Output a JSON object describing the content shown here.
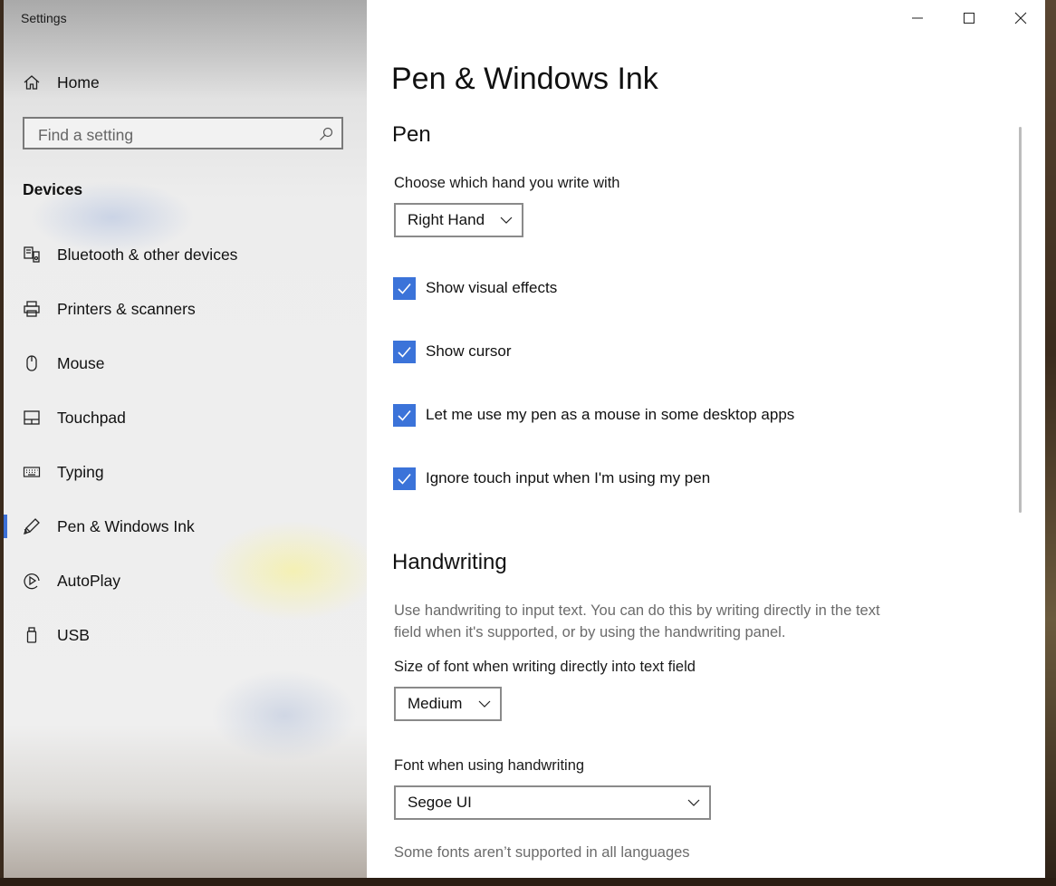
{
  "window": {
    "app_title": "Settings",
    "caption": {
      "minimize": "minimize-icon",
      "maximize": "maximize-icon",
      "close": "close-icon"
    }
  },
  "sidebar": {
    "home_label": "Home",
    "search_placeholder": "Find a setting",
    "section_label": "Devices",
    "items": [
      {
        "label": "Bluetooth & other devices",
        "icon": "bluetooth-devices-icon"
      },
      {
        "label": "Printers & scanners",
        "icon": "printer-icon"
      },
      {
        "label": "Mouse",
        "icon": "mouse-icon"
      },
      {
        "label": "Touchpad",
        "icon": "touchpad-icon"
      },
      {
        "label": "Typing",
        "icon": "keyboard-icon"
      },
      {
        "label": "Pen & Windows Ink",
        "icon": "pen-icon",
        "active": true
      },
      {
        "label": "AutoPlay",
        "icon": "autoplay-icon"
      },
      {
        "label": "USB",
        "icon": "usb-icon"
      }
    ],
    "accent_color": "#3b6fd6"
  },
  "main": {
    "page_title": "Pen & Windows Ink",
    "pen_heading": "Pen",
    "hand_label": "Choose which hand you write with",
    "hand_value": "Right Hand",
    "checkboxes": [
      {
        "label": "Show visual effects",
        "checked": true
      },
      {
        "label": "Show cursor",
        "checked": true
      },
      {
        "label": "Let me use my pen as a mouse in some desktop apps",
        "checked": true
      },
      {
        "label": "Ignore touch input when I'm using my pen",
        "checked": true
      }
    ],
    "handwriting_heading": "Handwriting",
    "handwriting_description": "Use handwriting to input text. You can do this by writing directly in the text field when it's supported, or by using the handwriting panel.",
    "font_size_label": "Size of font when writing directly into text field",
    "font_size_value": "Medium",
    "font_label": "Font when using handwriting",
    "font_value": "Segoe UI",
    "font_note": "Some fonts aren’t supported in all languages",
    "checkbox_color": "#3b73d9"
  }
}
